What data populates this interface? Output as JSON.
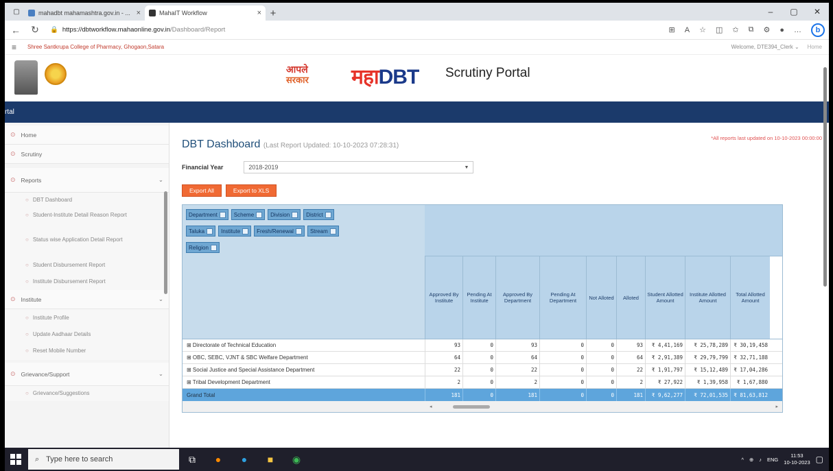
{
  "browser": {
    "tabs": [
      {
        "title": "mahadbt mahamashtra.gov.in - ...",
        "active": false
      },
      {
        "title": "MahaIT Workflow",
        "active": true
      }
    ],
    "url_host": "https://dbtworkflow.mahaonline.gov.in",
    "url_path": "/Dashboard/Report"
  },
  "site": {
    "college": "Shree Santkrupa College of Pharmacy, Ghogaon,Satara",
    "welcome": "Welcome, DTE394_Clerk",
    "home_link": "Home",
    "logo_marathi_1": "आपले",
    "logo_marathi_2": "सरकार",
    "brand_maha": "महा",
    "brand_dbt": "DBT",
    "portal_name": "Scrutiny Portal",
    "bluebar": "rtal"
  },
  "sidebar": {
    "items": [
      {
        "label": "Home",
        "type": "item"
      },
      {
        "label": "Scrutiny",
        "type": "item"
      },
      {
        "label": "Reports",
        "type": "group"
      },
      {
        "label": "DBT Dashboard",
        "type": "sub"
      },
      {
        "label": "Student-Institute Detail Reason Report",
        "type": "sub"
      },
      {
        "label": "Status wise Application Detail Report",
        "type": "sub"
      },
      {
        "label": "Student Disbursement Report",
        "type": "sub"
      },
      {
        "label": "Institute Disbursement Report",
        "type": "sub"
      },
      {
        "label": "Institute",
        "type": "group"
      },
      {
        "label": "Institute Profile",
        "type": "sub"
      },
      {
        "label": "Update Aadhaar Details",
        "type": "sub"
      },
      {
        "label": "Reset Mobile Number",
        "type": "sub"
      },
      {
        "label": "Grievance/Support",
        "type": "group"
      },
      {
        "label": "Grievance/Suggestions",
        "type": "sub"
      }
    ]
  },
  "dashboard": {
    "title": "DBT Dashboard",
    "updated": "(Last Report Updated: 10-10-2023 07:28:31)",
    "note": "*All reports last updated on 10-10-2023 00:00:00",
    "fy_label": "Financial Year",
    "fy_value": "2018-2019",
    "export_all": "Export All",
    "export_xls": "Export to XLS"
  },
  "pivot": {
    "fields": [
      "Department",
      "Scheme",
      "Division",
      "District",
      "Taluka",
      "Institute",
      "Fresh/Renewal",
      "Stream",
      "Religion"
    ],
    "columns": [
      "Approved By Institute",
      "Pending At Institute",
      "Approved By Department",
      "Pending At Department",
      "Not Alloted",
      "Alloted",
      "Student Allotted Amount",
      "Institute Allotted Amount",
      "Total Allotted Amount"
    ],
    "rows": [
      {
        "label": "⊞ Directorate of Technical Education",
        "values": [
          "93",
          "0",
          "93",
          "0",
          "0",
          "93",
          "₹ 4,41,169",
          "₹ 25,78,289",
          "₹ 30,19,458"
        ]
      },
      {
        "label": "⊞ OBC, SEBC, VJNT & SBC Welfare Department",
        "values": [
          "64",
          "0",
          "64",
          "0",
          "0",
          "64",
          "₹ 2,91,389",
          "₹ 29,79,799",
          "₹ 32,71,188"
        ]
      },
      {
        "label": "⊞ Social Justice and Special Assistance Department",
        "values": [
          "22",
          "0",
          "22",
          "0",
          "0",
          "22",
          "₹ 1,91,797",
          "₹ 15,12,489",
          "₹ 17,04,286"
        ]
      },
      {
        "label": "⊞ Tribal Development Department",
        "values": [
          "2",
          "0",
          "2",
          "0",
          "0",
          "2",
          "₹ 27,922",
          "₹ 1,39,958",
          "₹ 1,67,880"
        ]
      }
    ],
    "total": {
      "label": "Grand Total",
      "values": [
        "181",
        "0",
        "181",
        "0",
        "0",
        "181",
        "₹ 9,62,277",
        "₹ 72,01,535",
        "₹ 81,63,812"
      ]
    }
  },
  "taskbar": {
    "search_placeholder": "Type here to search",
    "lang": "ENG",
    "time": "11:53",
    "date": "10-10-2023"
  },
  "colors": {
    "brand_blue": "#1b3a6b",
    "accent_orange": "#f06a34",
    "pivot_total": "#5ea5dc"
  }
}
